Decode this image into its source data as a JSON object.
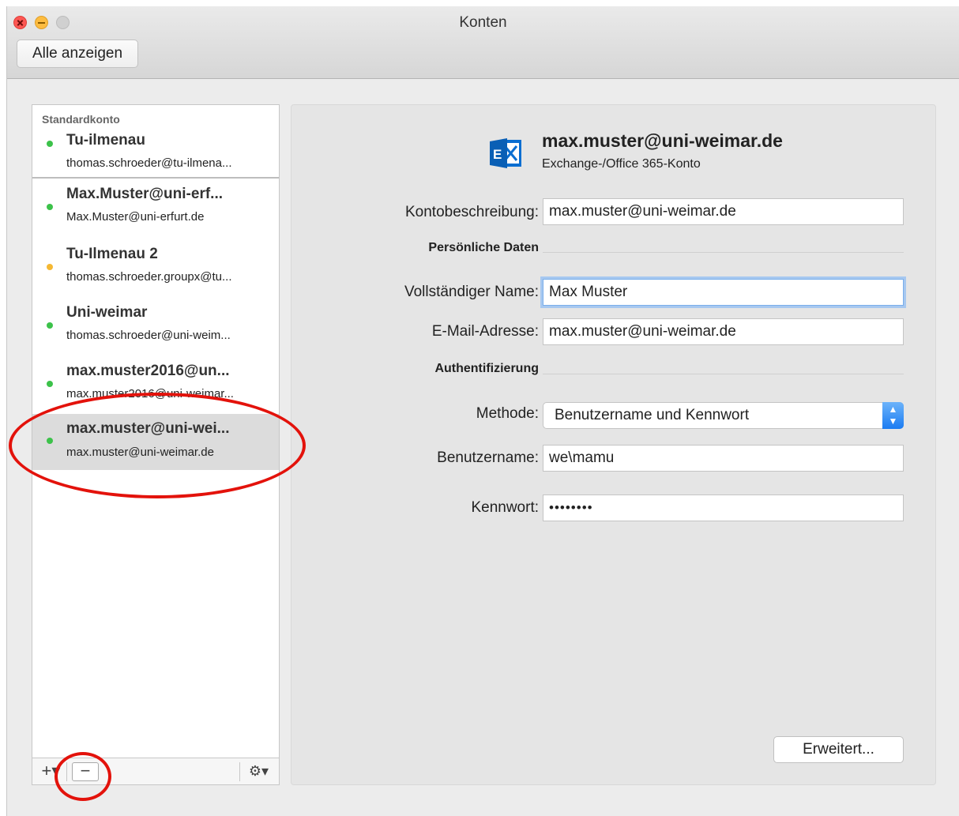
{
  "window": {
    "title": "Konten",
    "show_all_label": "Alle anzeigen"
  },
  "sidebar": {
    "section_label": "Standardkonto",
    "accounts": [
      {
        "name": "Tu-ilmenau",
        "email": "thomas.schroeder@tu-ilmena...",
        "status": "#3cc24a"
      },
      {
        "name": "Max.Muster@uni-erf...",
        "email": "Max.Muster@uni-erfurt.de",
        "status": "#3cc24a"
      },
      {
        "name": "Tu-Ilmenau 2",
        "email": "thomas.schroeder.groupx@tu...",
        "status": "#f5b833"
      },
      {
        "name": "Uni-weimar",
        "email": "thomas.schroeder@uni-weim...",
        "status": "#3cc24a"
      },
      {
        "name": "max.muster2016@un...",
        "email": "max.muster2016@uni-weimar...",
        "status": "#3cc24a"
      },
      {
        "name": "max.muster@uni-wei...",
        "email": "max.muster@uni-weimar.de",
        "status": "#3cc24a",
        "selected": true
      }
    ],
    "footer": {
      "add": "+▾",
      "remove": "−",
      "gear": "⚙▾"
    }
  },
  "detail": {
    "account_title": "max.muster@uni-weimar.de",
    "account_type": "Exchange-/Office 365-Konto",
    "logo_icon": "exchange-icon",
    "fields": {
      "description_label": "Kontobeschreibung:",
      "description_value": "max.muster@uni-weimar.de",
      "personal_header": "Persönliche Daten",
      "fullname_label": "Vollständiger Name:",
      "fullname_value": "Max Muster",
      "email_label": "E-Mail-Adresse:",
      "email_value": "max.muster@uni-weimar.de",
      "auth_header": "Authentifizierung",
      "method_label": "Methode:",
      "method_value": "Benutzername und Kennwort",
      "username_label": "Benutzername:",
      "username_value": "we\\mamu",
      "password_label": "Kennwort:",
      "password_value": "••••••••"
    },
    "advanced_label": "Erweitert..."
  },
  "colors": {
    "annotation": "#e3120b",
    "exchange_blue": "#0a6ed1",
    "select_accent": "#1b7cf2"
  }
}
